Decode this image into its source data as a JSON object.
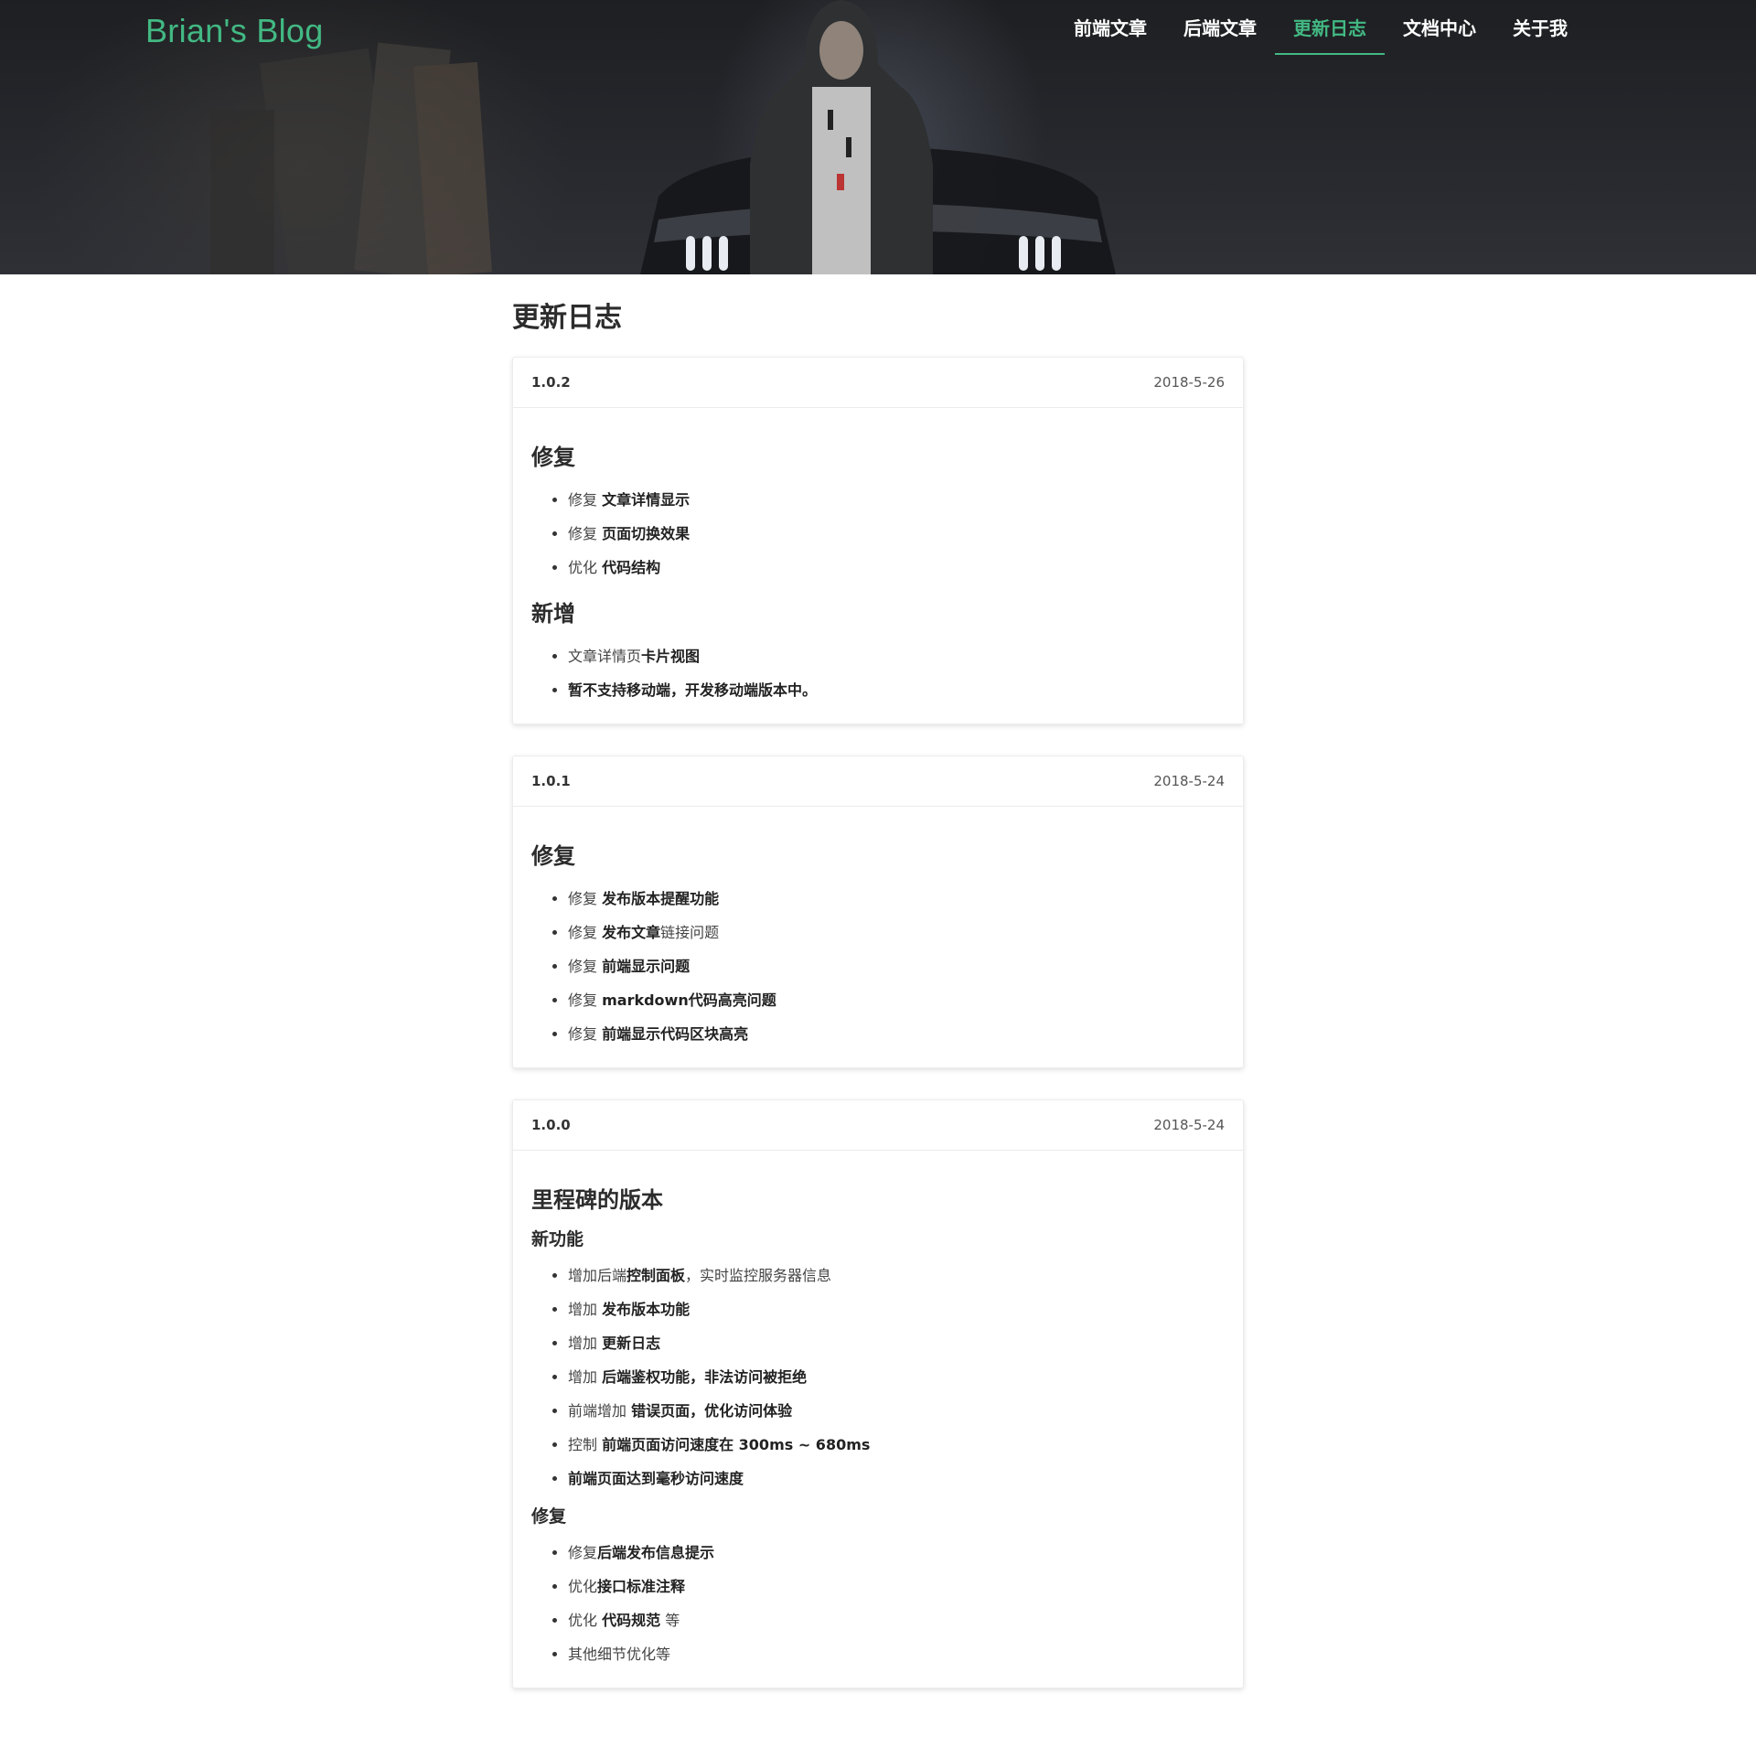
{
  "header": {
    "brand": "Brian's Blog",
    "nav": [
      {
        "label": "前端文章",
        "active": false
      },
      {
        "label": "后端文章",
        "active": false
      },
      {
        "label": "更新日志",
        "active": true
      },
      {
        "label": "文档中心",
        "active": false
      },
      {
        "label": "关于我",
        "active": false
      }
    ]
  },
  "page": {
    "title": "更新日志"
  },
  "colors": {
    "accent": "#42b983",
    "hero_bg": "#232428"
  },
  "releases": [
    {
      "version": "1.0.2",
      "date": "2018-5-26",
      "sections": [
        {
          "heading": "修复",
          "items": [
            {
              "plain": "修复 ",
              "bold": "文章详情显示",
              "tail": ""
            },
            {
              "plain": "修复 ",
              "bold": "页面切换效果",
              "tail": ""
            },
            {
              "plain": "优化 ",
              "bold": "代码结构",
              "tail": ""
            }
          ]
        },
        {
          "heading": "新增",
          "items": [
            {
              "plain": "文章详情页",
              "bold": "卡片视图",
              "tail": ""
            },
            {
              "plain": "",
              "bold": "暂不支持移动端，开发移动端版本中。",
              "tail": ""
            }
          ]
        }
      ]
    },
    {
      "version": "1.0.1",
      "date": "2018-5-24",
      "sections": [
        {
          "heading": "修复",
          "items": [
            {
              "plain": "修复 ",
              "bold": "发布版本提醒功能",
              "tail": ""
            },
            {
              "plain": "修复 ",
              "bold": "发布文章",
              "tail": "链接问题"
            },
            {
              "plain": "修复 ",
              "bold": "前端显示问题",
              "tail": ""
            },
            {
              "plain": "修复 ",
              "bold": "markdown代码高亮问题",
              "tail": ""
            },
            {
              "plain": "修复 ",
              "bold": "前端显示代码区块高亮",
              "tail": ""
            }
          ]
        }
      ]
    },
    {
      "version": "1.0.0",
      "date": "2018-5-24",
      "title": "里程碑的版本",
      "sections": [
        {
          "heading": "新功能",
          "items": [
            {
              "plain": "增加后端",
              "bold": "控制面板",
              "tail": "，实时监控服务器信息"
            },
            {
              "plain": "增加 ",
              "bold": "发布版本功能",
              "tail": ""
            },
            {
              "plain": "增加 ",
              "bold": "更新日志",
              "tail": ""
            },
            {
              "plain": "增加 ",
              "bold": "后端鉴权功能，非法访问被拒绝",
              "tail": ""
            },
            {
              "plain": "前端增加 ",
              "bold": "错误页面，优化访问体验",
              "tail": ""
            },
            {
              "plain": "控制 ",
              "bold": "前端页面访问速度在 300ms ~ 680ms",
              "tail": ""
            },
            {
              "plain": "",
              "bold": "前端页面达到毫秒访问速度",
              "tail": ""
            }
          ]
        },
        {
          "heading": "修复",
          "items": [
            {
              "plain": "修复",
              "bold": "后端发布信息提示",
              "tail": ""
            },
            {
              "plain": "优化",
              "bold": "接口标准注释",
              "tail": ""
            },
            {
              "plain": "优化 ",
              "bold": "代码规范",
              "tail": " 等"
            },
            {
              "plain": "其他细节优化等",
              "bold": "",
              "tail": ""
            }
          ]
        }
      ]
    }
  ]
}
